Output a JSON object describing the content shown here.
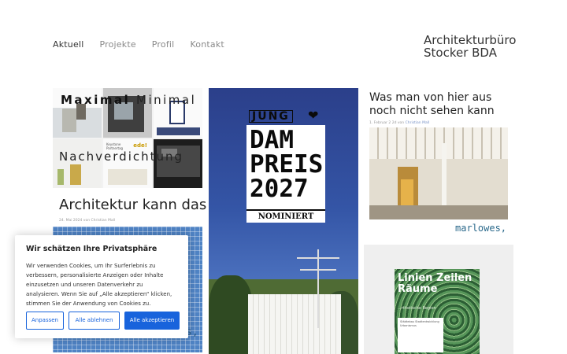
{
  "nav": {
    "items": [
      {
        "label": "Aktuell",
        "active": true
      },
      {
        "label": "Projekte",
        "active": false
      },
      {
        "label": "Profil",
        "active": false
      },
      {
        "label": "Kontakt",
        "active": false
      }
    ]
  },
  "brand": {
    "line1": "Architekturbüro",
    "line2": "Stocker BDA"
  },
  "post1": {
    "image_title_bold": "Maximal",
    "image_title_light": "Minimal",
    "image_title_2": "Nachverdichtung",
    "image_tag": "ede!",
    "image_small": "Keystone Partnertag",
    "title": "Architektur kann das",
    "meta": "24. Mai 2024 von Christian Mall",
    "overlay_text": "s,"
  },
  "post2": {
    "jung": "JUNG",
    "heart": "❤",
    "dam_lines": [
      "DAM",
      "PREIS",
      "2027"
    ],
    "nominated": "NOMINIERT"
  },
  "post3": {
    "title": "Was man von hier aus noch nicht sehen kann",
    "meta_date": "1. Februar 2 2d von",
    "meta_author": "Christian Mall",
    "caption": "marlowes,"
  },
  "post4": {
    "book_title": "Linien Zeilen Räume",
    "book_sub": "...rthetische Region",
    "book_label": "Städtebau Stadtentwicklung Urbanismus"
  },
  "cookie": {
    "title": "Wir schätzen Ihre Privatsphäre",
    "text": "Wir verwenden Cookies, um Ihr Surferlebnis zu verbessern, personalisierte Anzeigen oder Inhalte einzusetzen und unseren Datenverkehr zu analysieren. Wenn Sie auf „Alle akzeptieren“ klicken, stimmen Sie der Anwendung von Cookies zu.",
    "btn_customize": "Anpassen",
    "btn_reject": "Alle ablehnen",
    "btn_accept": "Alle akzeptieren",
    "accent": "#1863dc"
  }
}
